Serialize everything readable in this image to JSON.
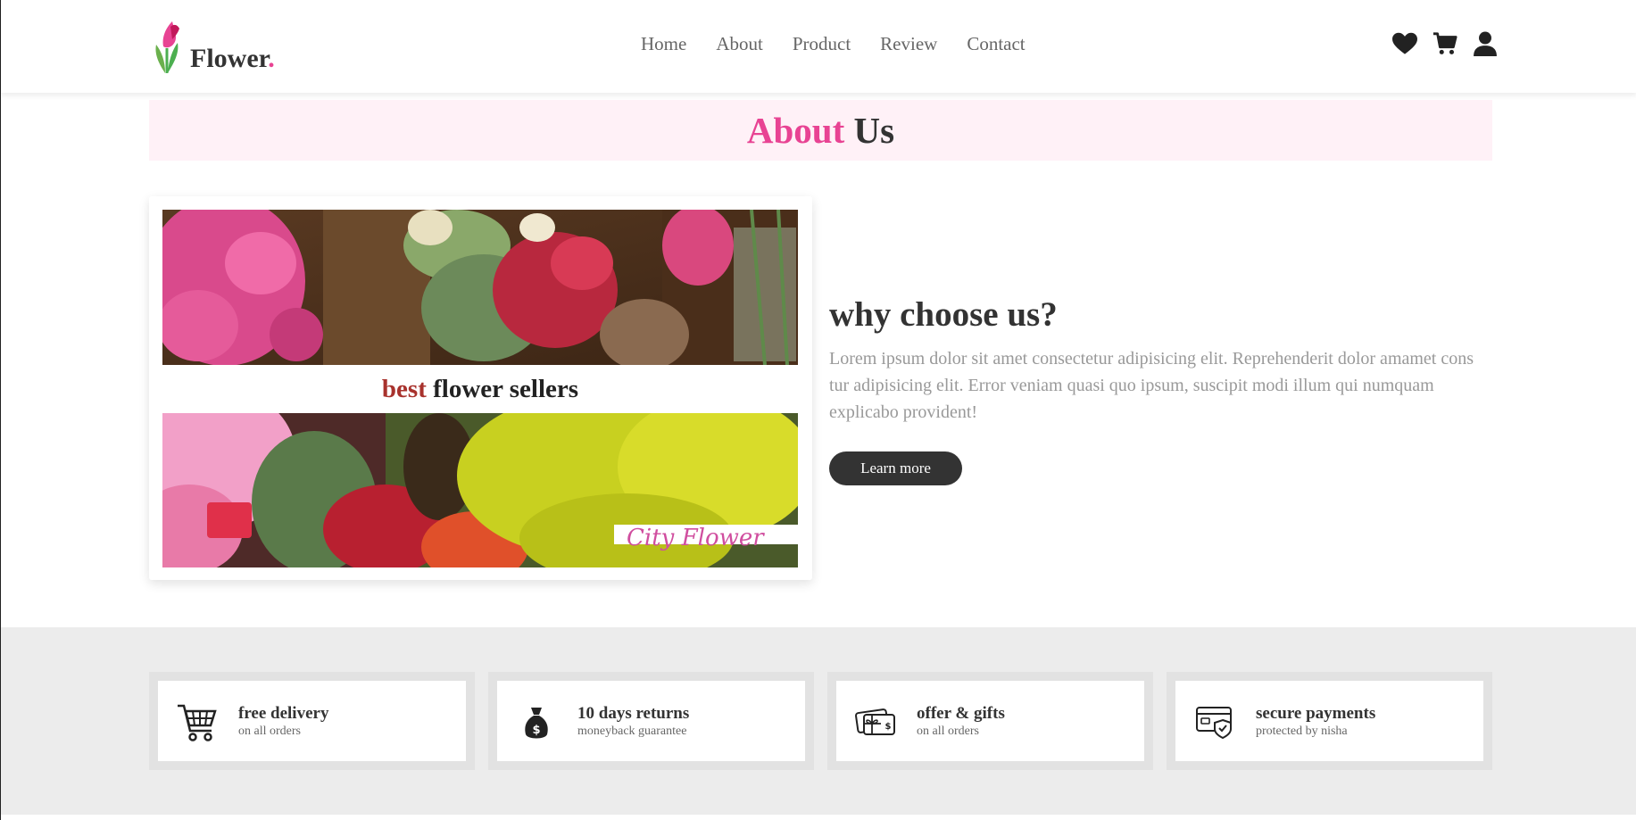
{
  "brand": {
    "name": "Flower",
    "dot": "."
  },
  "nav": {
    "items": [
      "Home",
      "About",
      "Product",
      "Review",
      "Contact"
    ]
  },
  "header_icons": [
    "heart-icon",
    "cart-icon",
    "user-icon"
  ],
  "about": {
    "title_accent": "About",
    "title_rest": "Us"
  },
  "video": {
    "title_accent": "best",
    "title_rest": "flower sellers",
    "watermark": "City Flower"
  },
  "why": {
    "title": "why choose us?",
    "text": "Lorem ipsum dolor sit amet consectetur adipisicing elit. Reprehenderit dolor amamet cons tur adipisicing elit. Error veniam quasi quo ipsum, suscipit modi illum qui numquam explicabo provident!",
    "button": "Learn more"
  },
  "features": [
    {
      "icon": "shopping-cart-icon",
      "title": "free delivery",
      "subtitle": "on all orders"
    },
    {
      "icon": "money-bag-icon",
      "title": "10 days returns",
      "subtitle": "moneyback guarantee"
    },
    {
      "icon": "gift-card-icon",
      "title": "offer & gifts",
      "subtitle": "on all orders"
    },
    {
      "icon": "secure-card-icon",
      "title": "secure payments",
      "subtitle": "protected by nisha"
    }
  ],
  "colors": {
    "accent": "#e84393",
    "dark": "#333333",
    "banner_bg": "#fff1f7",
    "features_bg": "#ececec"
  }
}
